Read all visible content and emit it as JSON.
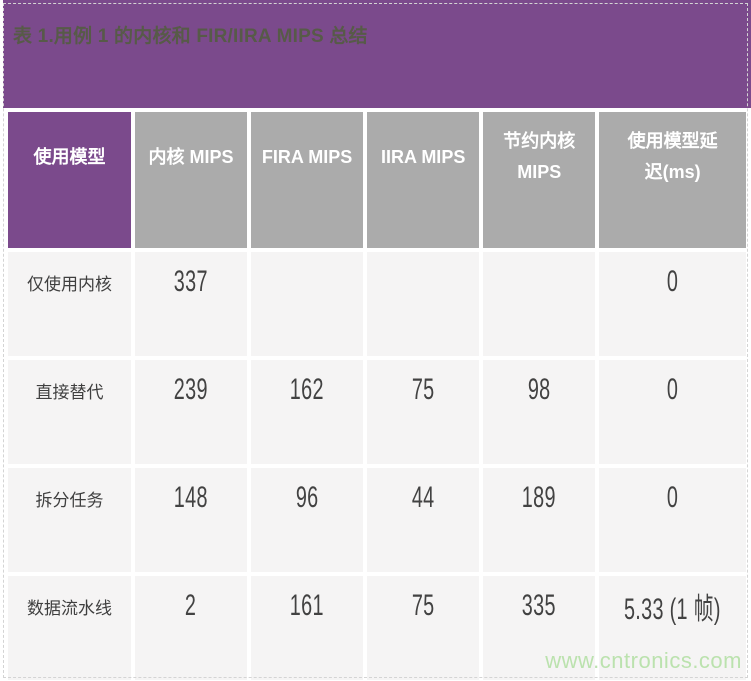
{
  "banner": {
    "title": "表 1.用例 1 的内核和 FIR/IIRA MIPS 总结"
  },
  "chart_data": {
    "type": "table",
    "title": "表 1.用例 1 的内核和 FIR/IIRA MIPS 总结",
    "columns": [
      "使用模型",
      "内核 MIPS",
      "FIRA MIPS",
      "IIRA MIPS",
      "节约内核 MIPS",
      "使用模型延迟(ms)"
    ],
    "rows": [
      [
        "仅使用内核",
        "337",
        "",
        "",
        "",
        "0"
      ],
      [
        "直接替代",
        "239",
        "162",
        "75",
        "98",
        "0"
      ],
      [
        "拆分任务",
        "148",
        "96",
        "44",
        "189",
        "0"
      ],
      [
        "数据流水线",
        "2",
        "161",
        "75",
        "335",
        "5.33 (1 帧)"
      ]
    ]
  },
  "watermark": {
    "text": "www.cntronics.com"
  },
  "colors": {
    "accent_purple": "#7B4A8C",
    "header_gray": "#ABABAB",
    "row_background": "#F5F4F4",
    "title_text": "#575A48",
    "header_text": "#FFFFFF",
    "body_text": "#3F3F3F",
    "watermark_green": "#BBE2AE",
    "dashed_border": "#D4D4D4"
  }
}
